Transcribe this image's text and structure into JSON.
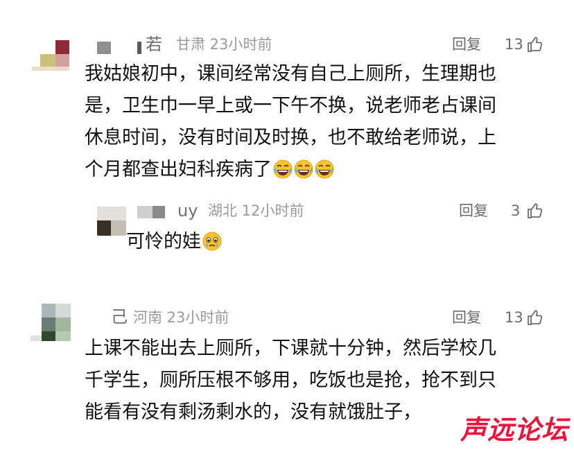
{
  "comments": [
    {
      "name_suffix": "若",
      "meta": "甘肃 23小时前",
      "reply_label": "回复",
      "likes": "13",
      "lines": [
        "我姑娘初中，课间经常没有自己上厕所，生理期也",
        "是，卫生巾一早上或一下午不换，说老师老占课间",
        "休息时间，没有时间及时换，也不敢给老师说，上",
        "个月都查出妇科疾病了"
      ],
      "emojis": [
        "laugh-cry-emoji",
        "laugh-cry-emoji",
        "laugh-cry-emoji"
      ]
    },
    {
      "name_suffix": "uy",
      "meta": "湖北 12小时前",
      "reply_label": "回复",
      "likes": "3",
      "lines": [
        "可怜的娃"
      ],
      "emojis": [
        "crying-emoji"
      ]
    },
    {
      "name_suffix": "己",
      "meta": "河南 23小时前",
      "reply_label": "回复",
      "likes": "13",
      "lines": [
        "上课不能出去上厕所，下课就十分钟，然后学校几",
        "千学生，厕所压根不够用，吃饭也是抢，抢不到只",
        "能看有没有剩汤剩水的，没有就饿肚子，"
      ]
    }
  ],
  "watermark": "声远论坛",
  "colors": {
    "text": "#111111",
    "meta": "#9a9a9a",
    "action": "#6b6b6b",
    "watermark": "#e8163a"
  }
}
